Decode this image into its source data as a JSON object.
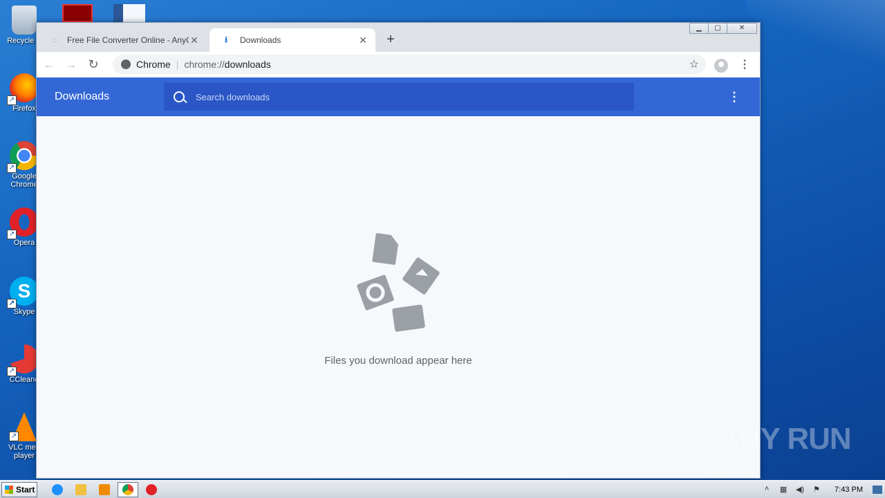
{
  "desktop": {
    "icons": [
      {
        "label": "Recycle B",
        "icon": "recycle-bin-icon"
      },
      {
        "label": "Firefox",
        "icon": "firefox-icon"
      },
      {
        "label": "Google Chrome",
        "icon": "chrome-icon"
      },
      {
        "label": "Opera",
        "icon": "opera-icon"
      },
      {
        "label": "Skype",
        "icon": "skype-icon"
      },
      {
        "label": "CCleane",
        "icon": "ccleaner-icon"
      },
      {
        "label": "VLC med player",
        "icon": "vlc-icon"
      }
    ],
    "top_icons": [
      "acrobat-icon",
      "word-icon"
    ]
  },
  "browser": {
    "tabs": [
      {
        "title": "Free File Converter Online - AnyCon",
        "active": false,
        "icon": "loading-spinner-icon"
      },
      {
        "title": "Downloads",
        "active": true,
        "icon": "download-icon"
      }
    ],
    "new_tab_label": "+",
    "omnibox": {
      "scheme_label": "Chrome",
      "separator": "|",
      "url_prefix": "chrome://",
      "url_path": "downloads"
    }
  },
  "downloads_page": {
    "title": "Downloads",
    "search_placeholder": "Search downloads",
    "empty_message": "Files you download appear here"
  },
  "taskbar": {
    "start_label": "Start",
    "clock": "7:43 PM"
  },
  "watermark": "ANY RUN",
  "colors": {
    "header_blue": "#3367d6",
    "search_blue": "#2a56c6",
    "illustration_gray": "#9aa0a6"
  }
}
